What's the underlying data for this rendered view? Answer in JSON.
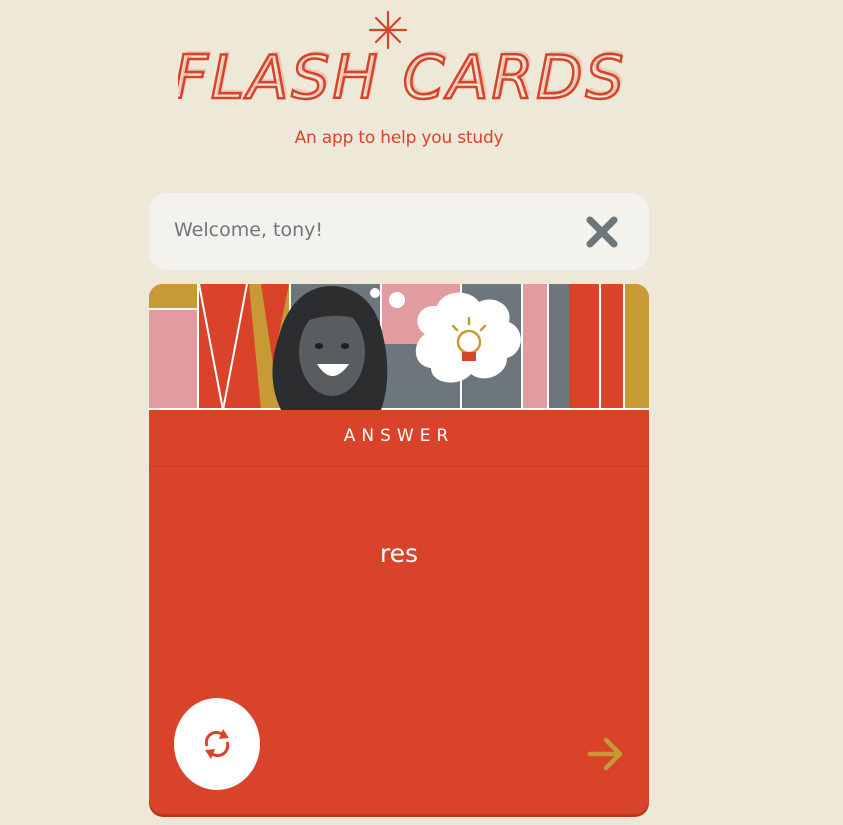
{
  "header": {
    "logo_text": "FLASH CARDS",
    "subtitle": "An app to help you study"
  },
  "welcome": {
    "message": "Welcome, tony!",
    "close_icon": "close-icon"
  },
  "card": {
    "side_label": "ANSWER",
    "content": "res",
    "flip_icon": "refresh-icon",
    "next_icon": "arrow-right-icon"
  },
  "colors": {
    "background": "#EDE8D8",
    "accent_red": "#D9432A",
    "mustard": "#C79A35",
    "pink": "#E29CA0",
    "slate": "#6E767D",
    "welcome_bg": "#F4F2EC"
  }
}
